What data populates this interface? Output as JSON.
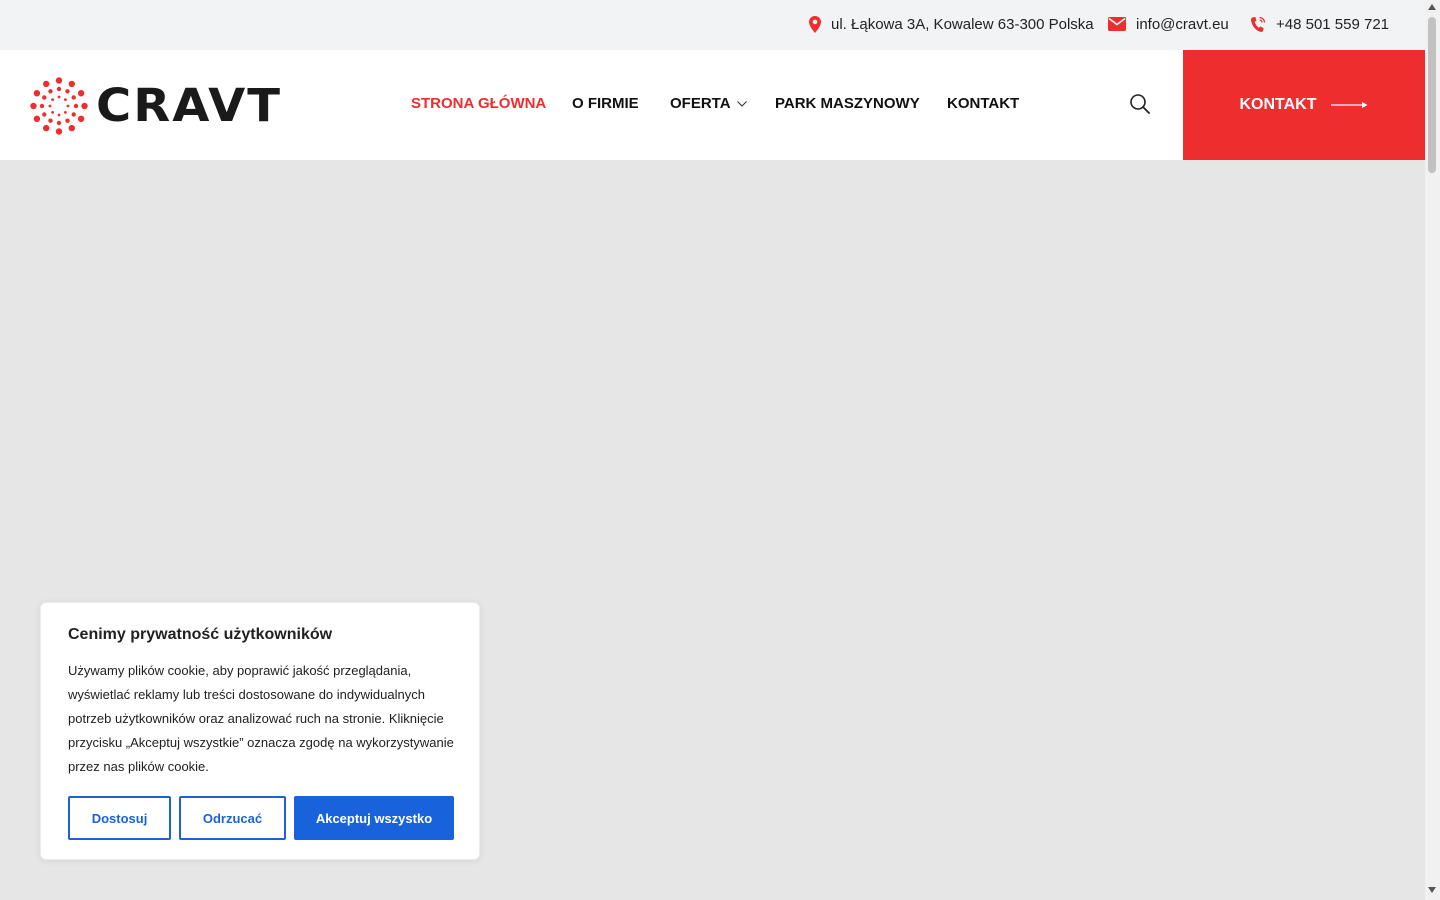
{
  "topbar": {
    "address": "ul. Łąkowa 3A, Kowalew 63-300 Polska",
    "email": "info@cravt.eu",
    "phone": "+48 501 559 721"
  },
  "logo": {
    "text": "CRAVT"
  },
  "nav": {
    "items": [
      {
        "label": "STRONA GŁÓWNA",
        "active": true
      },
      {
        "label": "O FIRMIE"
      },
      {
        "label": "OFERTA",
        "has_dropdown": true
      },
      {
        "label": "PARK MASZYNOWY"
      },
      {
        "label": "KONTAKT"
      }
    ]
  },
  "cta": {
    "label": "KONTAKT"
  },
  "cookie": {
    "title": "Cenimy prywatność użytkowników",
    "text": "Używamy plików cookie, aby poprawić jakość przeglądania, wyświetlać reklamy lub treści dostosowane do indywidualnych potrzeb użytkowników oraz analizować ruch na stronie. Kliknięcie przycisku „Akceptuj wszystkie” oznacza zgodę na wykorzystywanie przez nas plików cookie.",
    "customize_label": "Dostosuj",
    "reject_label": "Odrzucać",
    "accept_label": "Akceptuj wszystko"
  },
  "colors": {
    "accent": "#ee2e2e",
    "cookie_blue": "#1863dc",
    "topbar_bg": "#f2f3f5",
    "hero_bg": "#e6e6e6"
  },
  "icons": {
    "address": "map-pin-icon",
    "email": "envelope-icon",
    "phone": "phone-icon",
    "search": "search-icon",
    "dropdown": "chevron-down-icon",
    "cta": "arrow-right-icon"
  }
}
